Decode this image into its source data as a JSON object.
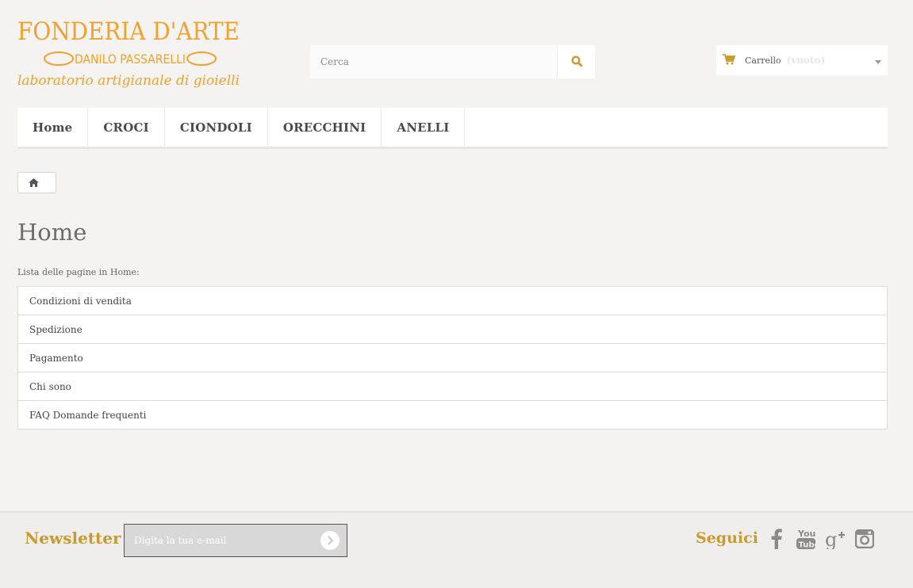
{
  "logo": {
    "line1": "FONDERIA D'ARTE",
    "line2": "DANILO PASSARELLI",
    "line3": "laboratorio artigianale di gioielli"
  },
  "search": {
    "placeholder": "Cerca",
    "icon": "search-icon"
  },
  "cart": {
    "label": "Carrello",
    "status": "(vuoto)",
    "icon": "shopping-cart-icon"
  },
  "menu": {
    "items": [
      {
        "label": "Home"
      },
      {
        "label": "CROCI"
      },
      {
        "label": "CIONDOLI"
      },
      {
        "label": "ORECCHINI"
      },
      {
        "label": "ANELLI"
      }
    ]
  },
  "breadcrumb": {
    "icon": "home-icon"
  },
  "main": {
    "title": "Home",
    "list_label": "Lista delle pagine in Home:",
    "pages": [
      "Condizioni di vendita",
      "Spedizione",
      "Pagamento",
      "Chi sono",
      "FAQ Domande frequenti"
    ]
  },
  "footer": {
    "newsletter_title": "Newsletter",
    "newsletter_placeholder": "Digita la tua e-mail",
    "social_title": "Seguici",
    "social_icons": [
      "facebook-icon",
      "youtube-icon",
      "google-plus-icon",
      "instagram-icon"
    ]
  },
  "colors": {
    "accent": "#c99a2e",
    "logo_orange": "#f0a22c",
    "background": "#f4f3f1"
  }
}
